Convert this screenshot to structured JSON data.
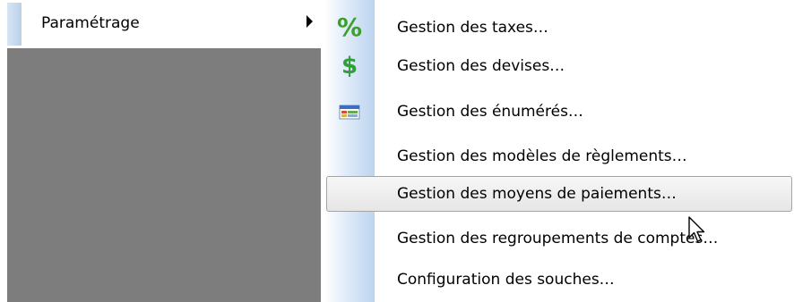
{
  "parent_menu": {
    "item_label": "Paramétrage"
  },
  "submenu": {
    "items": [
      {
        "label": "Gestion des taxes…",
        "icon": "percent-icon"
      },
      {
        "label": "Gestion des devises…",
        "icon": "dollar-icon"
      },
      {
        "label": "Gestion des énumérés…",
        "icon": "list-table-icon"
      },
      {
        "label": "Gestion des modèles de règlements…",
        "icon": ""
      },
      {
        "label": "Gestion des moyens de paiements…",
        "icon": "",
        "highlighted": true
      },
      {
        "label": "Gestion des regroupements de comptes…",
        "icon": ""
      },
      {
        "label": "Configuration des souches…",
        "icon": ""
      }
    ]
  },
  "colors": {
    "highlight_border": "#a4a4a4",
    "strip_blue": "#bcd4ef",
    "parent_background": "#7d7d7d",
    "percent_icon": "#3aa02c",
    "dollar_icon": "#2f9f3a"
  }
}
